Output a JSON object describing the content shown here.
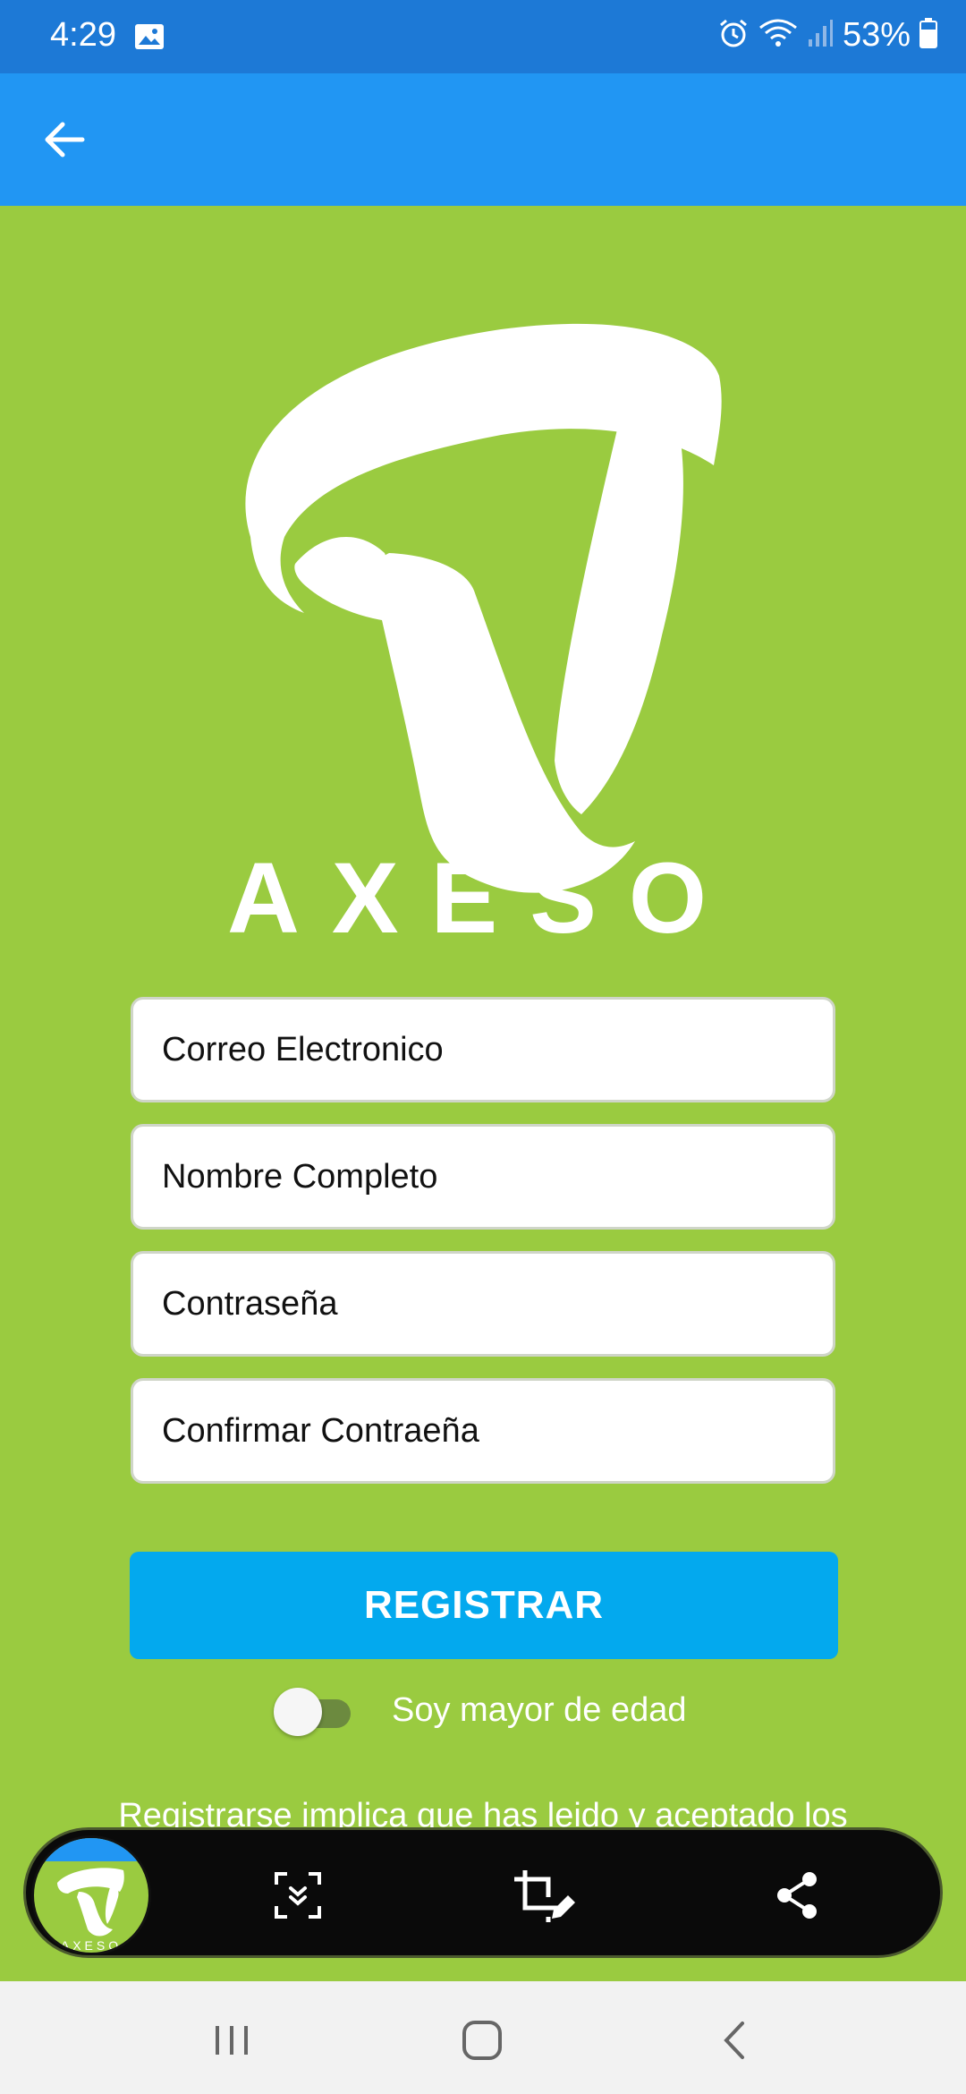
{
  "status": {
    "time": "4:29",
    "battery": "53%",
    "icons": [
      "image-icon",
      "alarm-icon",
      "wifi-icon",
      "signal-icon",
      "battery-icon"
    ]
  },
  "app_bar": {
    "back_icon": "arrow-back-icon"
  },
  "brand": {
    "name": "AXESO"
  },
  "form": {
    "email_placeholder": "Correo Electronico",
    "name_placeholder": "Nombre Completo",
    "password_placeholder": "Contraseña",
    "confirm_placeholder": "Confirmar Contraeña",
    "register_label": "REGISTRAR",
    "adult_toggle_label": "Soy mayor de edad",
    "adult_toggle_on": false,
    "terms_text": "Registrarse implica que has leido y aceptado los"
  },
  "capture_toolbar": {
    "thumbnail_text": "AXESO",
    "buttons": [
      "scroll-capture-icon",
      "crop-edit-icon",
      "share-icon"
    ]
  },
  "nav": {
    "buttons": [
      "recent-apps-icon",
      "home-icon",
      "back-nav-icon"
    ]
  },
  "colors": {
    "background": "#9acb40",
    "status_bar": "#1d79d6",
    "app_bar": "#2196f3",
    "register_button": "#03a9ee"
  }
}
